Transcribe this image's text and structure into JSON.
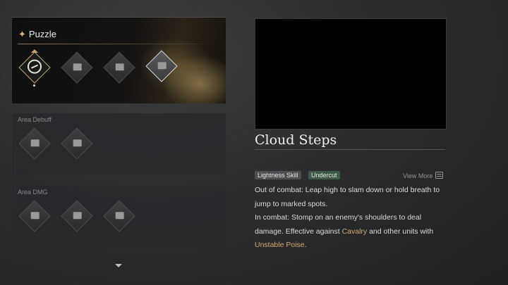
{
  "puzzle": {
    "title": "Puzzle",
    "star_icon": "sparkle-icon",
    "skills": [
      {
        "icon": "leap-skill-icon",
        "state": "active"
      },
      {
        "icon": "skill-slot-icon",
        "state": "normal"
      },
      {
        "icon": "skill-slot-icon",
        "state": "normal"
      },
      {
        "icon": "skill-slot-icon",
        "state": "selected"
      }
    ]
  },
  "categories": [
    {
      "label": "Area Debuff",
      "skill_count": 2
    },
    {
      "label": "Area DMG",
      "skill_count": 3
    }
  ],
  "detail": {
    "title": "Cloud Steps",
    "tag_type": "Lightness Skill",
    "tag_subtype": "Undercut",
    "view_more": "View More",
    "desc_line1": "Out of combat: Leap high to slam down or hold breath to jump to marked spots.",
    "desc_line2_pre": "In combat: Stomp on an enemy's shoulders to deal damage. Effective against ",
    "desc_hl1": "Cavalry",
    "desc_line2_mid": " and other units with ",
    "desc_hl2": "Unstable Poise",
    "desc_line2_post": "."
  },
  "colors": {
    "gold_accent": "#c9a66a",
    "highlight_text": "#d9a869",
    "subtype_tag": "#3e5a49"
  }
}
